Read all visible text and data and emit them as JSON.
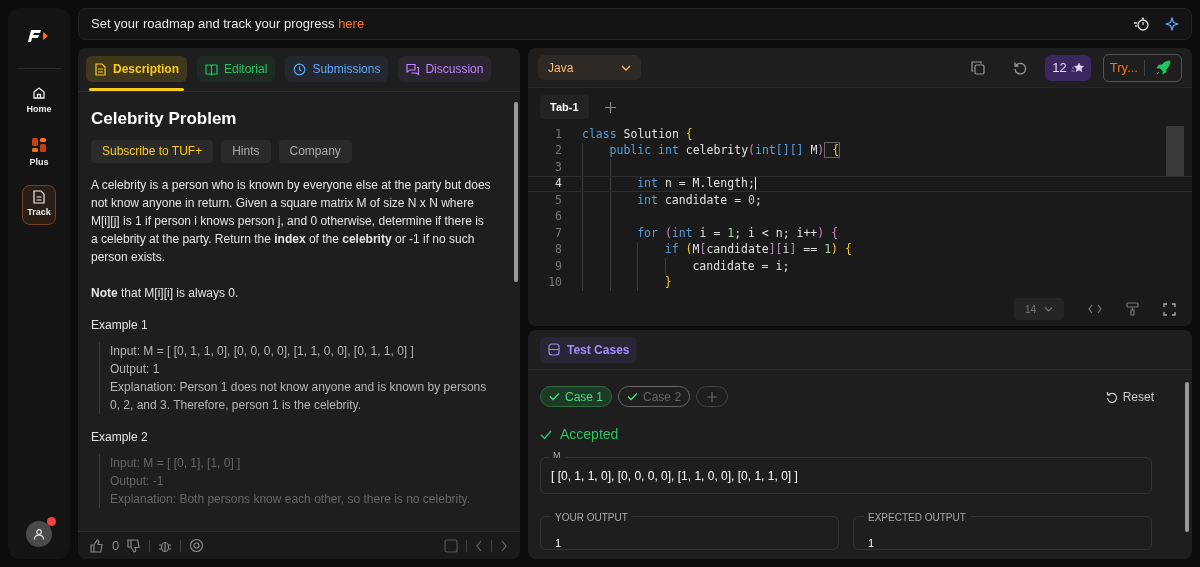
{
  "banner": {
    "text": "Set your roadmap and track your progress ",
    "link": "here"
  },
  "sidebar": {
    "items": [
      {
        "label": "Home",
        "selected": false
      },
      {
        "label": "Plus",
        "selected": false
      },
      {
        "label": "Track",
        "selected": true
      }
    ],
    "notification": true
  },
  "tabs": [
    {
      "label": "Description",
      "selected": true
    },
    {
      "label": "Editorial",
      "selected": false
    },
    {
      "label": "Submissions",
      "selected": false
    },
    {
      "label": "Discussion",
      "selected": false
    }
  ],
  "problem": {
    "title": "Celebrity Problem",
    "chips": [
      {
        "label": "Subscribe to TUF+",
        "kind": "premium"
      },
      {
        "label": "Hints",
        "kind": "plain"
      },
      {
        "label": "Company",
        "kind": "plain"
      }
    ],
    "paragraphs": [
      "A celebrity is a person who is known by everyone else at the party but does not know anyone in return. Given a square matrix M of size N x N where M[i][j] is 1 if person i knows person j, and 0 otherwise, determine if there is a celebrity at the party. Return the **index** of the **celebrity** or -1 if no such person exists.",
      "**Note** that M[i][i] is always 0."
    ],
    "examples": [
      {
        "title": "Example 1",
        "lines": [
          "Input: M = [ [0, 1, 1, 0], [0, 0, 0, 0], [1, 1, 0, 0], [0, 1, 1, 0] ]",
          "Output: 1",
          "Explanation: Person 1 does not know anyone and is known by persons 0, 2, and 3. Therefore, person 1 is the celebrity."
        ],
        "faded": false
      },
      {
        "title": "Example 2",
        "lines": [
          "Input: M = [ [0, 1], [1, 0] ]",
          "Output: -1",
          "Explanation: Both persons know each other, so there is no celebrity."
        ],
        "faded": true
      }
    ]
  },
  "footer": {
    "likes": "0"
  },
  "editor": {
    "language": "Java",
    "stars": "12",
    "try_label": "Try...",
    "tabs": [
      {
        "label": "Tab-1",
        "selected": true
      }
    ],
    "font_size": "14",
    "lines": [
      {
        "no": "1",
        "tokens": [
          {
            "text": "class ",
            "kind": "keyword"
          },
          {
            "text": "Solution ",
            "kind": "plain"
          },
          {
            "text": "{",
            "kind": "brace"
          }
        ]
      },
      {
        "no": "2",
        "tokens": [
          {
            "text": "    public int ",
            "kind": "keyword"
          },
          {
            "text": "celebrity",
            "kind": "plain"
          },
          {
            "text": "(",
            "kind": "paren"
          },
          {
            "text": "int",
            "kind": "keyword"
          },
          {
            "text": "[][]",
            "kind": "bracket"
          },
          {
            "text": " M",
            "kind": "plain"
          },
          {
            "text": ")",
            "kind": "paren"
          },
          {
            "text": " {",
            "kind": "matched"
          }
        ]
      },
      {
        "no": "3"
      },
      {
        "no": "4",
        "current": true,
        "tokens": [
          {
            "text": "        int ",
            "kind": "keyword"
          },
          {
            "text": "n = M.length;",
            "kind": "plain"
          }
        ]
      },
      {
        "no": "5",
        "current": false,
        "tokens": [
          {
            "text": "        int ",
            "kind": "keyword"
          },
          {
            "text": "candidate = ",
            "kind": "plain"
          },
          {
            "text": "0",
            "kind": "number"
          },
          {
            "text": ";",
            "kind": "plain"
          }
        ]
      },
      {
        "no": "6"
      },
      {
        "no": "7",
        "tokens": [
          {
            "text": "        for ",
            "kind": "keyword"
          },
          {
            "text": "(",
            "kind": "paren"
          },
          {
            "text": "int ",
            "kind": "keyword"
          },
          {
            "text": "i = ",
            "kind": "plain"
          },
          {
            "text": "1",
            "kind": "number"
          },
          {
            "text": "; i < n; i++",
            "kind": "plain"
          },
          {
            "text": ")",
            "kind": "paren"
          },
          {
            "text": " {",
            "kind": "paren"
          }
        ]
      },
      {
        "no": "8",
        "tokens": [
          {
            "text": "            if ",
            "kind": "keyword"
          },
          {
            "text": "(",
            "kind": "brace"
          },
          {
            "text": "M",
            "kind": "plain"
          },
          {
            "text": "[",
            "kind": "paren"
          },
          {
            "text": "candidate",
            "kind": "plain"
          },
          {
            "text": "][",
            "kind": "paren"
          },
          {
            "text": "i",
            "kind": "plain"
          },
          {
            "text": "]",
            "kind": "paren"
          },
          {
            "text": " == ",
            "kind": "plain"
          },
          {
            "text": "1",
            "kind": "number"
          },
          {
            "text": ")",
            "kind": "brace"
          },
          {
            "text": " {",
            "kind": "brace"
          }
        ]
      },
      {
        "no": "9",
        "tokens": [
          {
            "text": "                candidate = i;",
            "kind": "plain"
          }
        ]
      },
      {
        "no": "10",
        "tokens": [
          {
            "text": "            }",
            "kind": "brace"
          }
        ]
      }
    ]
  },
  "test_cases": {
    "title": "Test Cases",
    "cases": [
      {
        "label": "Case 1",
        "selected": true
      },
      {
        "label": "Case 2",
        "selected": false
      }
    ],
    "reset": "Reset",
    "verdict": "Accepted",
    "input_label": "M",
    "input_value": "[ [0, 1, 1, 0], [0, 0, 0, 0], [1, 1, 0, 0], [0, 1, 1, 0] ]",
    "outputs": [
      {
        "label": "YOUR OUTPUT",
        "value": "1"
      },
      {
        "label": "EXPECTED OUTPUT",
        "value": "1"
      }
    ]
  }
}
